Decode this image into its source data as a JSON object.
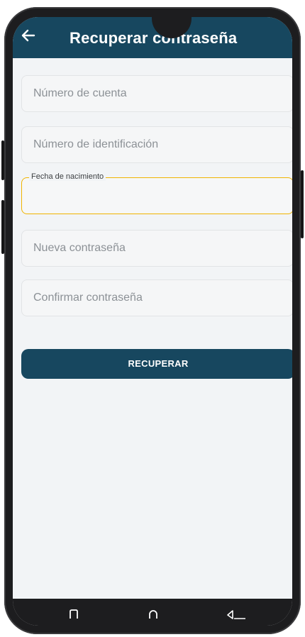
{
  "header": {
    "title": "Recuperar contraseña",
    "back_icon": "arrow-left-icon"
  },
  "form": {
    "account_number": {
      "placeholder": "Número de cuenta",
      "value": ""
    },
    "id_number": {
      "placeholder": "Número de identificación",
      "value": ""
    },
    "birth_date": {
      "label": "Fecha de nacimiento",
      "value": "",
      "focused": true
    },
    "new_password": {
      "placeholder": "Nueva contraseña",
      "value": ""
    },
    "confirm_password": {
      "placeholder": "Confirmar contraseña",
      "value": ""
    }
  },
  "actions": {
    "recover_label": "RECUPERAR"
  },
  "navbar": {
    "icons": [
      "recents-icon",
      "home-icon",
      "back-nav-icon"
    ]
  },
  "colors": {
    "primary": "#17475f",
    "focus": "#f0b400",
    "background": "#f2f4f6"
  }
}
